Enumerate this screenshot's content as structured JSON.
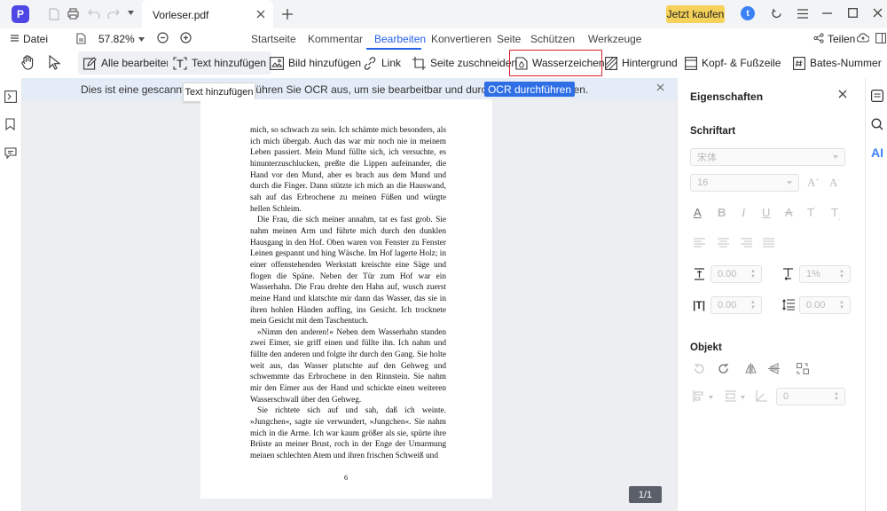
{
  "window": {
    "doc_tab_title": "Vorleser.pdf",
    "buy_label": "Jetzt kaufen"
  },
  "menu": {
    "file_label": "Datei",
    "zoom": "57.82%",
    "tabs": [
      "Startseite",
      "Kommentar",
      "Bearbeiten",
      "Konvertieren",
      "Seite",
      "Schützen",
      "Werkzeuge"
    ],
    "active_tab": "Bearbeiten",
    "share_label": "Teilen"
  },
  "toolbar": {
    "edit_all": "Alle bearbeiten",
    "add_text": "Text hinzufügen",
    "add_image": "Bild hinzufügen",
    "link": "Link",
    "crop_page": "Seite zuschneiden",
    "watermark": "Wasserzeichen",
    "background": "Hintergrund",
    "header_footer": "Kopf- & Fußzeile",
    "bates": "Bates-Nummer"
  },
  "ocr_banner": {
    "text": "Dies ist eine gescannte PDF-Datei. Führen Sie OCR aus, um sie bearbeitbar und durchsuchbar zu machen.",
    "button": "OCR durchführen"
  },
  "tooltip": "Text hinzufügen",
  "page": {
    "paragraphs": [
      "mich, so schwach zu sein. Ich schämte mich besonders, als ich mich übergab. Auch das war mir noch nie in meinem Leben passiert. Mein Mund füllte sich, ich versuchte, es hinunterzuschlucken, preßte die Lippen aufeinander, die Hand vor den Mund, aber es brach aus dem Mund und durch die Finger. Dann stützte ich mich an die Hauswand, sah auf das Erbrochene zu meinen Füßen und würgte hellen Schleim.",
      "Die Frau, die sich meiner annahm, tat es fast grob. Sie nahm meinen Arm und führte mich durch den dunklen Hausgang in den Hof. Oben waren von Fenster zu Fenster Leinen gespannt und hing Wäsche. Im Hof lagerte Holz; in einer offenstehenden Werkstatt kreischte eine Säge und flogen die Späne. Neben der Tür zum Hof war ein Wasserhahn. Die Frau drehte den Hahn auf, wusch zuerst meine Hand und klatschte mir dann das Wasser, das sie in ihren hohlen Händen auffing, ins Gesicht. Ich trocknete mein Gesicht mit dem Taschentuch.",
      "»Nimm den anderen!« Neben dem Wasserhahn standen zwei Eimer, sie griff einen und füllte ihn. Ich nahm und füllte den anderen und folgte ihr durch den Gang. Sie holte weit aus, das Wasser platschte auf den Gehweg und schwemmte das Erbrochene in den Rinnstein. Sie nahm mir den Eimer aus der Hand und schickte einen weiteren Wasserschwall über den Gehweg.",
      "Sie richtete sich auf und sah, daß ich weinte. »Jungchen«, sagte sie verwundert, »Jungchen«. Sie nahm mich in die Arme. Ich war kaum größer als sie, spürte ihre Brüste an meiner Brust, roch in der Enge der Umarmung meinen schlechten Atem und ihren frischen Schweiß und"
    ],
    "page_number": "6",
    "indicator": "1/1"
  },
  "properties": {
    "title": "Eigenschaften",
    "font_section": "Schriftart",
    "font_family": "宋体",
    "font_size": "16",
    "spacing_1": "0.00",
    "spacing_2": "1%",
    "spacing_3": "0.00",
    "spacing_4": "0.00",
    "object_section": "Objekt",
    "opacity": "0"
  },
  "colors": {
    "accent": "#2563eb",
    "ocr_button": "#2f6fe6",
    "highlight_box": "#d6202a",
    "buy_button": "#f6d25a"
  }
}
